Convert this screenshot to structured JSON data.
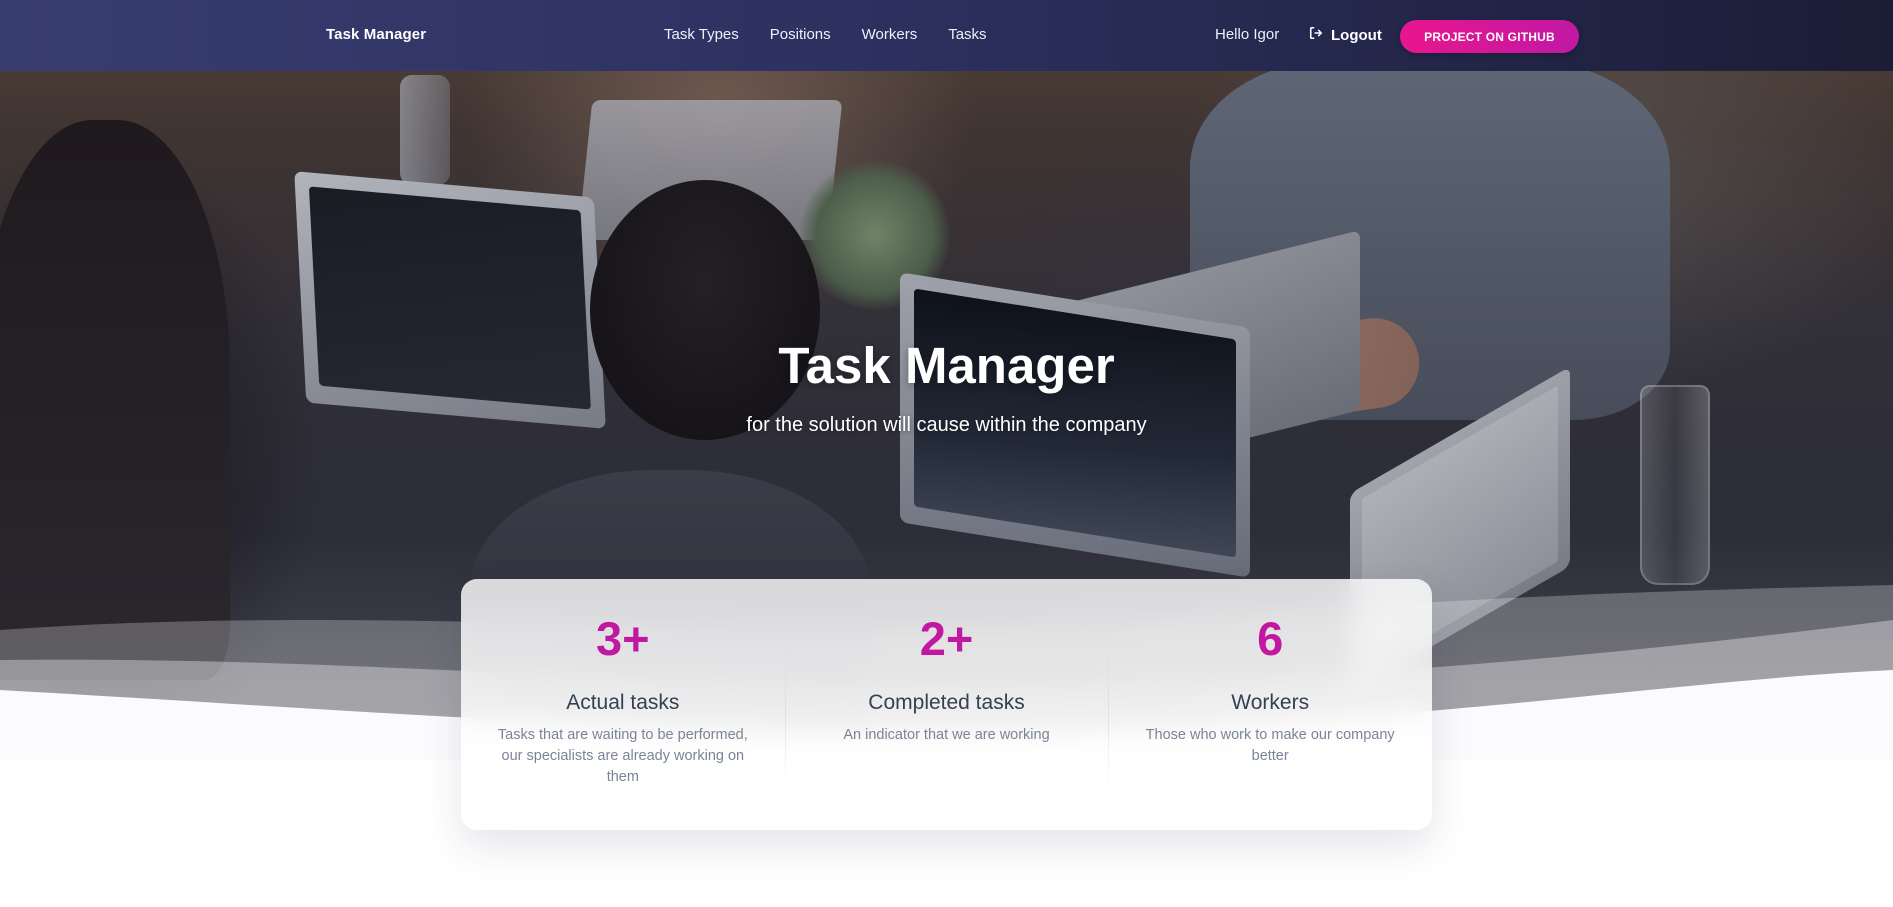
{
  "nav": {
    "brand": "Task Manager",
    "links": [
      "Task Types",
      "Positions",
      "Workers",
      "Tasks"
    ],
    "greeting": "Hello Igor",
    "logout_label": "Logout",
    "github_label": "PROJECT ON GITHUB"
  },
  "hero": {
    "title": "Task Manager",
    "subtitle": "for the solution will cause within the company"
  },
  "stats": [
    {
      "value": "3+",
      "label": "Actual tasks",
      "description": "Tasks that are waiting to be performed, our specialists are already working on them"
    },
    {
      "value": "2+",
      "label": "Completed tasks",
      "description": "An indicator that we are working"
    },
    {
      "value": "6",
      "label": "Workers",
      "description": "Those who work to make our company better"
    }
  ],
  "colors": {
    "accent": "#c218a1",
    "button_gradient_start": "#e8168d",
    "navbar_start": "#383d70",
    "navbar_end": "#1b1d36"
  },
  "icons": {
    "logout": "sign-out-icon"
  }
}
